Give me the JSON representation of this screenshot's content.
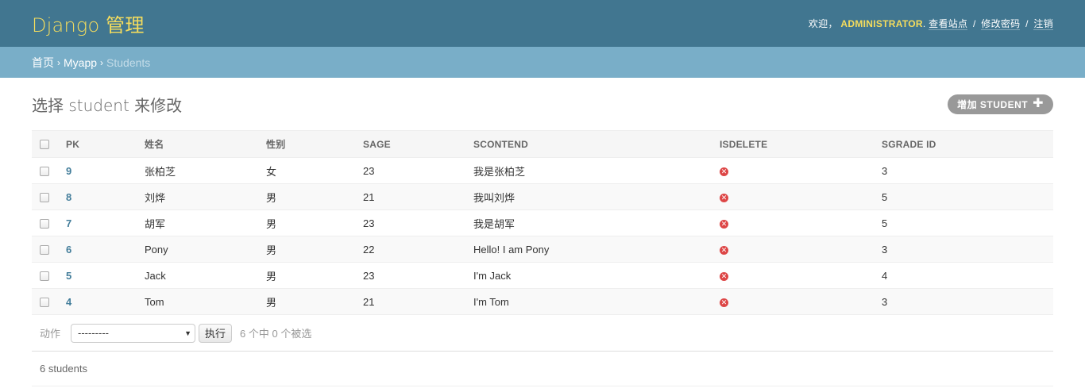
{
  "header": {
    "branding": "Django 管理",
    "welcome": "欢迎，",
    "username": "ADMINISTRATOR",
    "period": ".",
    "view_site": "查看站点",
    "change_password": "修改密码",
    "logout": "注销",
    "sep": "/"
  },
  "breadcrumbs": {
    "home": "首页",
    "app": "Myapp",
    "current": "Students",
    "arrow": "›"
  },
  "main": {
    "title": "选择 student 来修改",
    "add_button": "增加 STUDENT",
    "add_icon": "plus-icon"
  },
  "table": {
    "columns": [
      "PK",
      "姓名",
      "性别",
      "SAGE",
      "SCONTEND",
      "ISDELETE",
      "SGRADE ID"
    ],
    "rows": [
      {
        "pk": "9",
        "name": "张柏芝",
        "sex": "女",
        "age": "23",
        "content": "我是张柏芝",
        "isdelete": false,
        "grade": "3"
      },
      {
        "pk": "8",
        "name": "刘烨",
        "sex": "男",
        "age": "21",
        "content": "我叫刘烨",
        "isdelete": false,
        "grade": "5"
      },
      {
        "pk": "7",
        "name": "胡军",
        "sex": "男",
        "age": "23",
        "content": "我是胡军",
        "isdelete": false,
        "grade": "5"
      },
      {
        "pk": "6",
        "name": "Pony",
        "sex": "男",
        "age": "22",
        "content": "Hello! I am Pony",
        "isdelete": false,
        "grade": "3"
      },
      {
        "pk": "5",
        "name": "Jack",
        "sex": "男",
        "age": "23",
        "content": "I'm Jack",
        "isdelete": false,
        "grade": "4"
      },
      {
        "pk": "4",
        "name": "Tom",
        "sex": "男",
        "age": "21",
        "content": "I'm Tom",
        "isdelete": false,
        "grade": "3"
      }
    ]
  },
  "actions": {
    "label": "动作",
    "select_value": "---------",
    "go_label": "执行",
    "counter": "6 个中 0 个被选"
  },
  "paginator": {
    "text": "6 students"
  },
  "colors": {
    "header_bg": "#417690",
    "breadcrumb_bg": "#79aec8",
    "branding": "#f5dd5d",
    "link": "#447e9b",
    "boolean_false": "#dd4646"
  }
}
